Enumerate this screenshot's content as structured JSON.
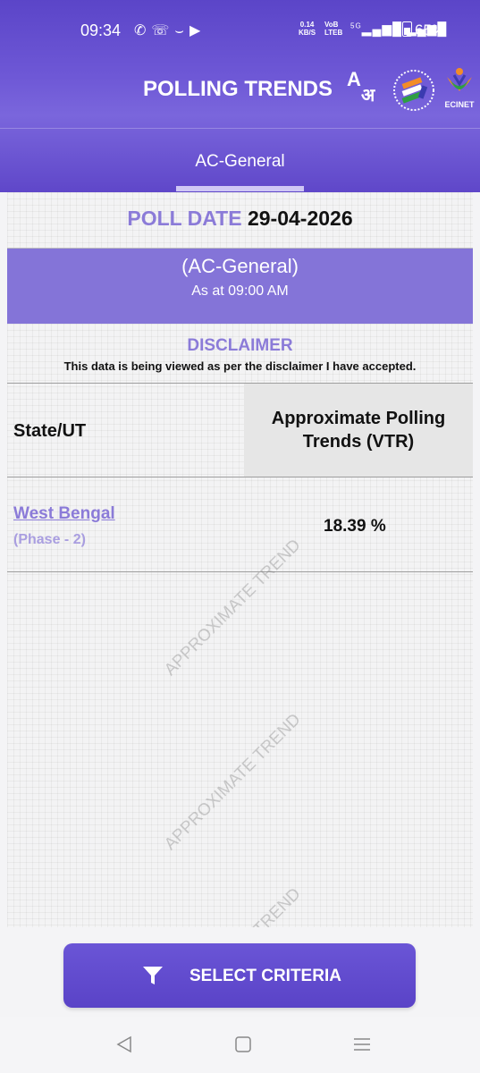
{
  "status_bar": {
    "time": "09:34",
    "net_speed_value": "0.14",
    "net_speed_unit": "KB/S",
    "volte_top": "VoB",
    "volte_bottom": "LTEB",
    "network": "5G",
    "battery": "65%"
  },
  "header": {
    "title_part1": "POLLING",
    "title_part2": "TRENDS",
    "lang_icon_text": "A",
    "lang_icon_text_hi": "अ",
    "ecinet_label": "ECINET"
  },
  "tabs": [
    {
      "label": "AC-General",
      "active": true
    }
  ],
  "poll_date": {
    "label": "POLL DATE",
    "value": "29-04-2026"
  },
  "banner": {
    "title": "(AC-General)",
    "subtitle": "As at 09:00 AM"
  },
  "disclaimer": {
    "title": "DISCLAIMER",
    "text": "This data is being viewed as per the disclaimer I have accepted."
  },
  "table": {
    "headers": [
      "State/UT",
      "Approximate Polling Trends (VTR)"
    ],
    "rows": [
      {
        "state": "West Bengal",
        "phase": "(Phase - 2)",
        "value": "18.39 %"
      }
    ]
  },
  "watermark_text": "APPROXIMATE TREND",
  "select_criteria": {
    "label": "SELECT CRITERIA"
  },
  "colors": {
    "primary": "#5b45c8",
    "accent_text": "#8b7bd8",
    "banner": "#8474d8"
  },
  "icons": [
    "whatsapp-icon",
    "whatsapp-business-icon",
    "youtube-icon",
    "funnel-icon",
    "back-icon",
    "home-icon",
    "recents-icon"
  ]
}
